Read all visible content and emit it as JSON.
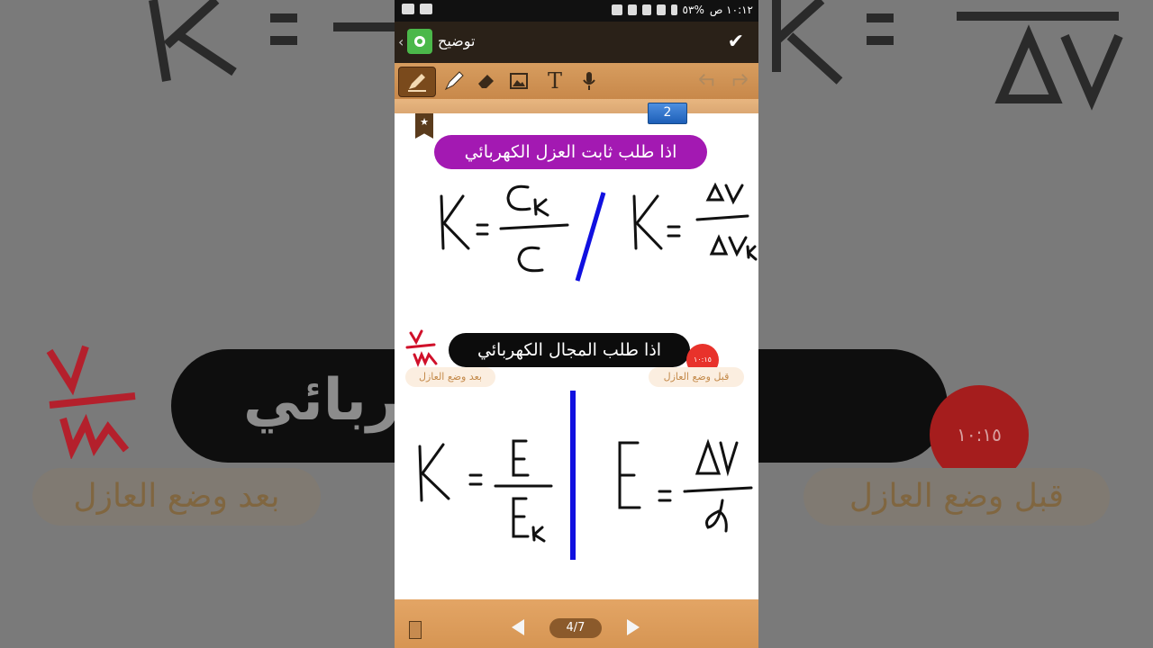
{
  "status_bar": {
    "time": "١٠:١٢ ص",
    "battery": "%٥٣"
  },
  "titlebar": {
    "title": "توضيح"
  },
  "toolbar": {
    "tools": [
      "pen-icon",
      "highlighter-icon",
      "eraser-icon",
      "image-icon",
      "text-icon",
      "mic-icon",
      "undo-icon",
      "redo-icon"
    ],
    "text_tool_label": "T"
  },
  "canvas": {
    "blue_tab_label": "2",
    "heading_purple": "اذا طلب ثابت العزل الكهربائي",
    "heading_black": "اذا طلب المجال الكهربائي",
    "tag_after": "بعد وضع العازل",
    "tag_before": "قبل وضع العازل",
    "red_timer": "١٠:١٥",
    "colors": {
      "purple": "#a319b2",
      "blue_ink": "#1010e0",
      "red_ink": "#d0102a"
    }
  },
  "bottom_bar": {
    "page_indicator": "4/7"
  }
}
